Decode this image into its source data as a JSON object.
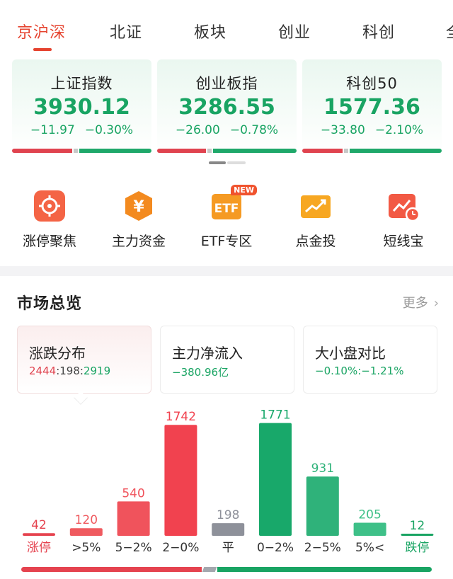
{
  "tabs": [
    {
      "label": "京沪深",
      "active": true
    },
    {
      "label": "北证",
      "active": false
    },
    {
      "label": "板块",
      "active": false
    },
    {
      "label": "创业",
      "active": false
    },
    {
      "label": "科创",
      "active": false
    },
    {
      "label": "全",
      "active": false
    }
  ],
  "index_cards": [
    {
      "name": "上证指数",
      "value": "3930.12",
      "change": "−11.97",
      "pct": "−0.30%",
      "up_ratio": 0.43
    },
    {
      "name": "创业板指",
      "value": "3286.55",
      "change": "−26.00",
      "pct": "−0.78%",
      "up_ratio": 0.35
    },
    {
      "name": "科创50",
      "value": "1577.36",
      "change": "−33.80",
      "pct": "−2.10%",
      "up_ratio": 0.29
    }
  ],
  "shortcuts": [
    {
      "label": "涨停聚焦",
      "icon": "target-icon"
    },
    {
      "label": "主力资金",
      "icon": "yen-hexagon-icon"
    },
    {
      "label": "ETF专区",
      "icon": "etf-icon",
      "badge": "NEW"
    },
    {
      "label": "点金投",
      "icon": "ticket-chart-icon"
    },
    {
      "label": "短线宝",
      "icon": "chart-clock-icon"
    }
  ],
  "overview": {
    "title": "市场总览",
    "more": "更多",
    "cards": [
      {
        "title": "涨跌分布",
        "up": "2444",
        "sep1": ":",
        "flat": "198",
        "sep2": ":",
        "down": "2919"
      },
      {
        "title": "主力净流入",
        "value": "−380.96亿"
      },
      {
        "title": "大小盘对比",
        "value": "−0.10%:−1.21%"
      }
    ]
  },
  "colors": {
    "up": "#e5434f",
    "down": "#19a463",
    "flat": "#8e919a",
    "accent": "#e5432f"
  },
  "chart_data": {
    "type": "bar",
    "categories": [
      "涨停",
      ">5%",
      "5−2%",
      "2−0%",
      "平",
      "0−2%",
      "2−5%",
      "5%<",
      "跌停"
    ],
    "values": [
      42,
      120,
      540,
      1742,
      198,
      1771,
      931,
      205,
      12
    ],
    "colors": [
      "#e5434f",
      "#ef5a5f",
      "#f0535c",
      "#f1424f",
      "#8e919a",
      "#18a86a",
      "#2fb27a",
      "#3ec088",
      "#19a463"
    ],
    "ylim": [
      0,
      1800
    ],
    "grid": false,
    "legend": "none"
  }
}
